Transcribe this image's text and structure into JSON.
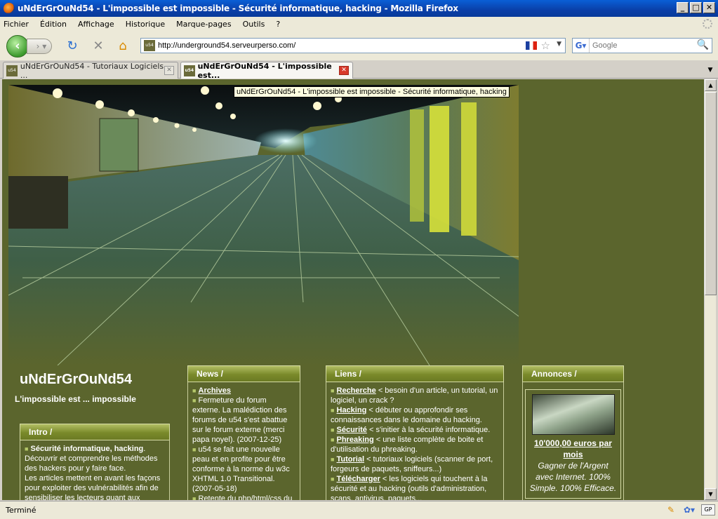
{
  "window": {
    "title": "uNdErGrOuNd54 - L'impossible est impossible - Sécurité informatique, hacking - Mozilla Firefox",
    "minimize": "_",
    "maximize": "□",
    "close": "✕"
  },
  "menu": [
    "Fichier",
    "Édition",
    "Affichage",
    "Historique",
    "Marque-pages",
    "Outils",
    "?"
  ],
  "toolbar": {
    "url": "http://underground54.serveurperso.com/",
    "search_placeholder": "Google",
    "icons": [
      "back-icon",
      "forward-icon",
      "reload-icon",
      "stop-icon",
      "home-icon"
    ]
  },
  "tabs": [
    {
      "label": "uNdErGrOuNd54 - Tutoriaux Logiciels - ...",
      "active": false
    },
    {
      "label": "uNdErGrOuNd54 - L'impossible est...",
      "active": true
    }
  ],
  "page": {
    "tooltip": "uNdErGrOuNd54 - L'impossible est impossible - Sécurité informatique, hacking",
    "site_title": "uNdErGrOuNd54",
    "site_subtitle": "L'impossible est ... impossible",
    "intro": {
      "heading": "Intro /",
      "lead": "Sécurité informatique, hacking",
      "text": "Découvrir et comprendre les méthodes des hackers pour y faire face.",
      "text2": "Les articles mettent en avant les façons pour exploiter des vulnérabilités afin de sensibiliser les lecteurs quant aux risques."
    },
    "news": {
      "heading": "News /",
      "archives": "Archives",
      "item1": "Fermeture du forum externe. La malédiction des forums de u54 s'est abattue sur le forum externe (merci papa noyel). (2007-12-25)",
      "item2": "u54 se fait une nouvelle peau et en profite pour être conforme à la norme du w3c XHTML 1.0 Transitional. (2007-05-18)",
      "item3": "Retente du php/html/css du"
    },
    "liens": {
      "heading": "Liens /",
      "items": [
        {
          "link": "Recherche",
          "desc": " < besoin d'un article, un tutorial, un logiciel, un crack ?"
        },
        {
          "link": "Hacking",
          "desc": " < débuter ou approfondir ses connaissances dans le domaine du hacking."
        },
        {
          "link": "Sécurité",
          "desc": " < s'initier à la sécurité informatique."
        },
        {
          "link": "Phreaking",
          "desc": " < une liste complète de boite et d'utilisation du phreaking."
        },
        {
          "link": "Tutorial",
          "desc": " < tutoriaux logiciels (scanner de port, forgeurs de paquets, sniffeurs...)"
        },
        {
          "link": "Télécharger",
          "desc": " < les logiciels qui touchent à la sécurité et au hacking (outils d'administration, scans, antivirus, paquets..."
        }
      ]
    },
    "annonces": {
      "heading": "Annonces /",
      "ad_title": "10'000,00 euros par mois",
      "ad_text": "Gagner de l'Argent avec Internet. 100% Simple. 100% Efficace."
    }
  },
  "status": {
    "text": "Terminé",
    "gp": "GP"
  }
}
